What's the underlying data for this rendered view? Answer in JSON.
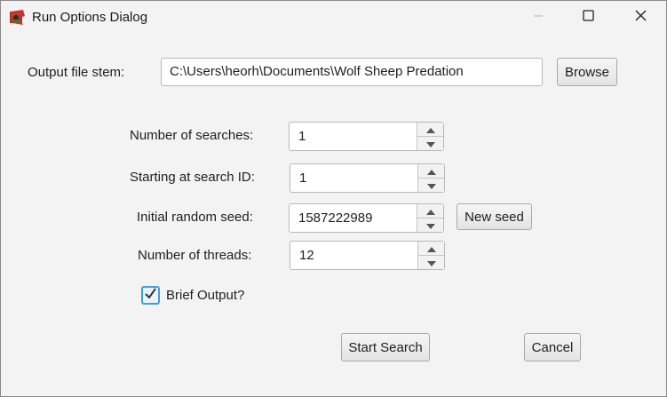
{
  "window": {
    "title": "Run Options Dialog",
    "icon": "sheep-app-icon",
    "controls": [
      "minimize-icon",
      "maximize-icon",
      "close-icon"
    ]
  },
  "output": {
    "label": "Output file stem:",
    "value": "C:\\Users\\heorh\\Documents\\Wolf Sheep Predation",
    "browse_label": "Browse"
  },
  "fields": {
    "searches": {
      "label": "Number of searches:",
      "value": "1"
    },
    "start_id": {
      "label": "Starting at search ID:",
      "value": "1"
    },
    "seed": {
      "label": "Initial random seed:",
      "value": "1587222989",
      "new_seed_label": "New seed"
    },
    "threads": {
      "label": "Number of threads:",
      "value": "12"
    }
  },
  "brief_output": {
    "label": "Brief Output?",
    "checked": true
  },
  "actions": {
    "start_label": "Start Search",
    "cancel_label": "Cancel"
  },
  "colors": {
    "checkbox_accent": "#3ea0d6",
    "background": "#f3f3f3"
  }
}
